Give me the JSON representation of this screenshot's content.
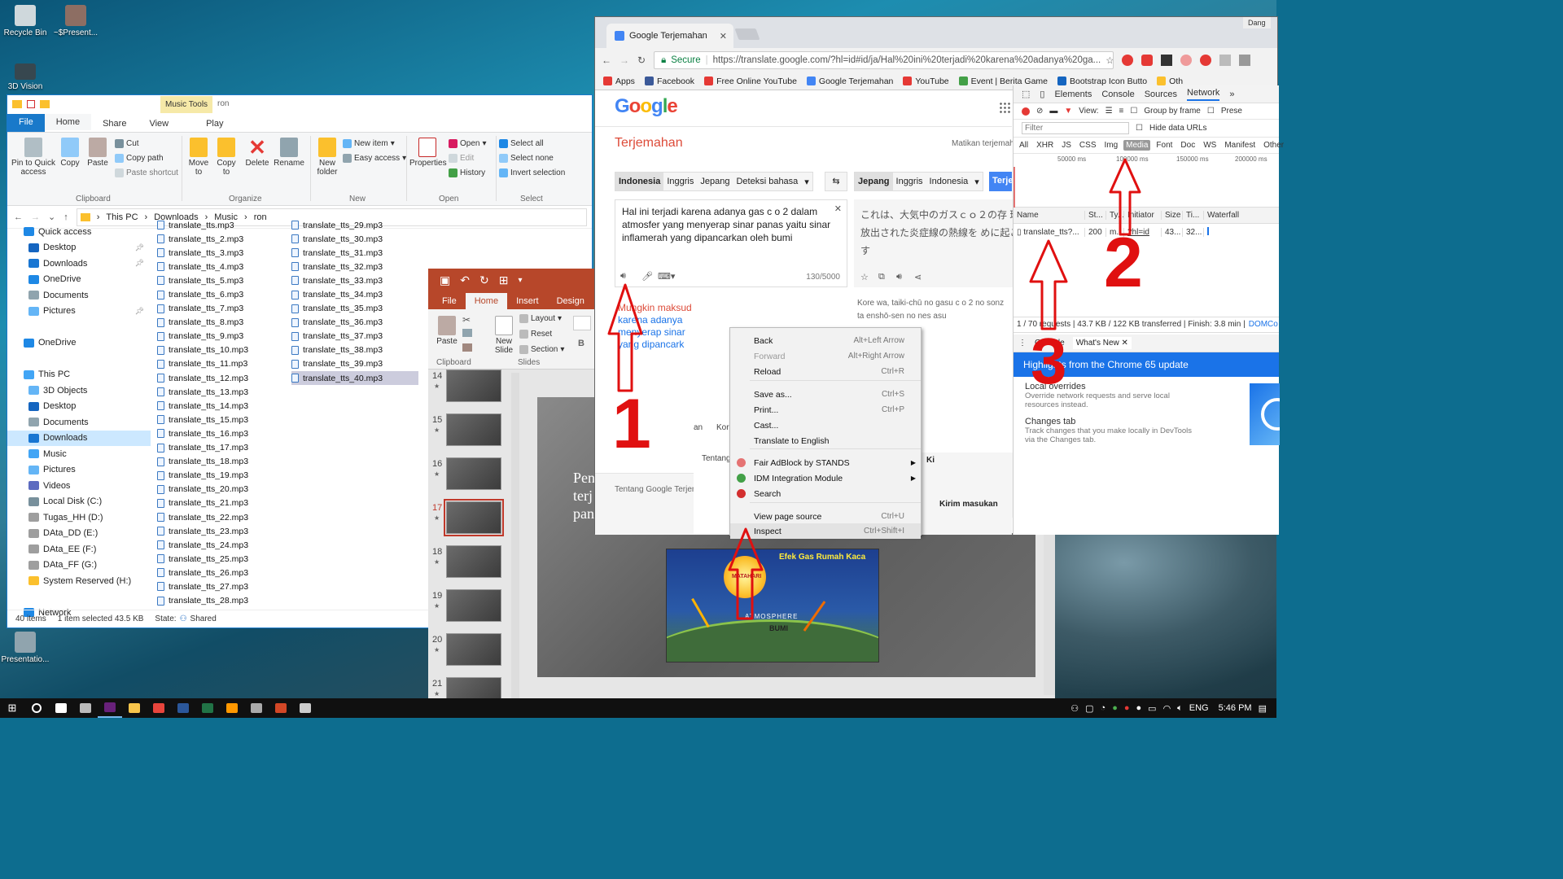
{
  "desktop": {
    "icons": [
      {
        "label": "Recycle Bin",
        "color": "#cfd8dc"
      },
      {
        "label": "~$Present...",
        "color": "#8d6e63"
      },
      {
        "label": "3D Vision",
        "color": "#37474f"
      },
      {
        "label": "Presentatio...",
        "color": "#90a4ae"
      }
    ]
  },
  "explorer": {
    "title": "ron",
    "context_tab": "Music Tools",
    "tabs": [
      "File",
      "Home",
      "Share",
      "View",
      "Play"
    ],
    "ribbon": {
      "clipboard": {
        "pin": "Pin to Quick\naccess",
        "copy": "Copy",
        "paste": "Paste",
        "cut": "Cut",
        "copy_path": "Copy path",
        "paste_shortcut": "Paste shortcut",
        "group": "Clipboard"
      },
      "organize": {
        "move": "Move\nto",
        "copy": "Copy\nto",
        "delete": "Delete",
        "rename": "Rename",
        "group": "Organize"
      },
      "new": {
        "folder": "New\nfolder",
        "new_item": "New item",
        "easy_access": "Easy access",
        "group": "New"
      },
      "open": {
        "properties": "Properties",
        "open": "Open",
        "edit": "Edit",
        "history": "History",
        "group": "Open"
      },
      "select": {
        "all": "Select all",
        "none": "Select none",
        "invert": "Invert selection",
        "group": "Select"
      }
    },
    "path": [
      "This PC",
      "Downloads",
      "Music",
      "ron"
    ],
    "nav": [
      {
        "label": "Quick access",
        "color": "#1e88e5",
        "indent": 0
      },
      {
        "label": "Desktop",
        "color": "#1565c0",
        "indent": 1
      },
      {
        "label": "Downloads",
        "color": "#1976d2",
        "indent": 1
      },
      {
        "label": "OneDrive",
        "color": "#1e88e5",
        "indent": 1
      },
      {
        "label": "Documents",
        "color": "#90a4ae",
        "indent": 1
      },
      {
        "label": "Pictures",
        "color": "#64b5f6",
        "indent": 1
      },
      {
        "label": "",
        "color": "",
        "indent": 0
      },
      {
        "label": "OneDrive",
        "color": "#1e88e5",
        "indent": 0
      },
      {
        "label": "",
        "color": "",
        "indent": 0
      },
      {
        "label": "This PC",
        "color": "#42a5f5",
        "indent": 0
      },
      {
        "label": "3D Objects",
        "color": "#64b5f6",
        "indent": 1
      },
      {
        "label": "Desktop",
        "color": "#1565c0",
        "indent": 1
      },
      {
        "label": "Documents",
        "color": "#90a4ae",
        "indent": 1
      },
      {
        "label": "Downloads",
        "color": "#1976d2",
        "indent": 1
      },
      {
        "label": "Music",
        "color": "#42a5f5",
        "indent": 1
      },
      {
        "label": "Pictures",
        "color": "#64b5f6",
        "indent": 1
      },
      {
        "label": "Videos",
        "color": "#5c6bc0",
        "indent": 1
      },
      {
        "label": "Local Disk (C:)",
        "color": "#78909c",
        "indent": 1
      },
      {
        "label": "Tugas_HH (D:)",
        "color": "#9e9e9e",
        "indent": 1
      },
      {
        "label": "DAta_DD (E:)",
        "color": "#9e9e9e",
        "indent": 1
      },
      {
        "label": "DAta_EE (F:)",
        "color": "#9e9e9e",
        "indent": 1
      },
      {
        "label": "DAta_FF (G:)",
        "color": "#9e9e9e",
        "indent": 1
      },
      {
        "label": "System Reserved (H:)",
        "color": "#fbc02d",
        "indent": 1
      },
      {
        "label": "",
        "color": "",
        "indent": 0
      },
      {
        "label": "Network",
        "color": "#1e88e5",
        "indent": 0
      }
    ],
    "files_col1": [
      "translate_tts.mp3",
      "translate_tts_2.mp3",
      "translate_tts_3.mp3",
      "translate_tts_4.mp3",
      "translate_tts_5.mp3",
      "translate_tts_6.mp3",
      "translate_tts_7.mp3",
      "translate_tts_8.mp3",
      "translate_tts_9.mp3",
      "translate_tts_10.mp3",
      "translate_tts_11.mp3",
      "translate_tts_12.mp3",
      "translate_tts_13.mp3",
      "translate_tts_14.mp3",
      "translate_tts_15.mp3",
      "translate_tts_16.mp3",
      "translate_tts_17.mp3",
      "translate_tts_18.mp3",
      "translate_tts_19.mp3",
      "translate_tts_20.mp3",
      "translate_tts_21.mp3",
      "translate_tts_22.mp3",
      "translate_tts_23.mp3",
      "translate_tts_24.mp3",
      "translate_tts_25.mp3",
      "translate_tts_26.mp3",
      "translate_tts_27.mp3",
      "translate_tts_28.mp3"
    ],
    "files_col2": [
      "translate_tts_29.mp3",
      "translate_tts_30.mp3",
      "translate_tts_31.mp3",
      "translate_tts_32.mp3",
      "translate_tts_33.mp3",
      "translate_tts_34.mp3",
      "translate_tts_35.mp3",
      "translate_tts_36.mp3",
      "translate_tts_37.mp3",
      "translate_tts_38.mp3",
      "translate_tts_39.mp3",
      "translate_tts_40.mp3"
    ],
    "selected_file": "translate_tts_40.mp3",
    "status": {
      "count": "40 items",
      "selected": "1 item selected  43.5 KB",
      "state": "State:",
      "shared": "Shared"
    }
  },
  "ppt": {
    "tabs": [
      "File",
      "Home",
      "Insert",
      "Design"
    ],
    "ribbon": {
      "paste": "Paste",
      "new_slide": "New\nSlide",
      "layout": "Layout",
      "reset": "Reset",
      "section": "Section",
      "clipboard": "Clipboard",
      "slides": "Slides"
    },
    "slide_numbers": [
      "14",
      "15",
      "16",
      "17",
      "18",
      "19",
      "20",
      "21"
    ],
    "active_slide": "17",
    "slide_text": [
      "Pen",
      "terj",
      "pan"
    ],
    "diagram": {
      "title": "Efek Gas Rumah Kaca",
      "sun": "MATAHARI",
      "atmosphere": "ATMOSPHERE",
      "earth": "BUMI"
    }
  },
  "chrome": {
    "tab_title": "Google Terjemahan",
    "url_secure": "Secure",
    "url": "https://translate.google.com/?hl=id#id/ja/Hal%20ini%20terjadi%20karena%20adanya%20ga...",
    "bookmarks": [
      {
        "label": "Apps",
        "color": "#e53935"
      },
      {
        "label": "Facebook",
        "color": "#3b5998"
      },
      {
        "label": "Free Online YouTube",
        "color": "#e53935"
      },
      {
        "label": "Google Terjemahan",
        "color": "#4285f4"
      },
      {
        "label": "YouTube",
        "color": "#e53935"
      },
      {
        "label": "Event | Berita Game",
        "color": "#43a047"
      },
      {
        "label": "Bootstrap Icon Butto",
        "color": "#1565c0"
      },
      {
        "label": "Oth",
        "color": "#fbc02d"
      }
    ],
    "user": "Dang",
    "translate": {
      "heading": "Terjemahan",
      "turn_off": "Matikan terjemah",
      "src_langs": [
        "Indonesia",
        "Inggris",
        "Jepang",
        "Deteksi bahasa"
      ],
      "tgt_langs": [
        "Jepang",
        "Inggris",
        "Indonesia"
      ],
      "translate_btn": "Terje",
      "source_text": "Hal ini terjadi karena adanya gas c o 2 dalam atmosfer yang menyerap sinar panas yaitu sinar inflamerah yang dipancarkan oleh bumi",
      "char_count": "130/5000",
      "result_text": "これは、大気中のガスｃｏ２の存 球から放出された炎症線の熱線を めに起こります",
      "romaji": "Kore wa, taiki-chū no gasu c o 2 no sonz ta enshō-sen no nes asu",
      "suggest_prefix": "Mungkin maksud",
      "suggest_lines": [
        "karena adanya",
        "menyerap sinar",
        "yang dipancark"
      ],
      "footer_about": "Tentang Google Terjem",
      "footer_send": "Kirim masukan",
      "footer_frag1": "Tentang",
      "footer_frag2": "an",
      "footer_frag3": "Kor",
      "footer_frag4": "Ki"
    },
    "devtools": {
      "tabs": [
        "Elements",
        "Console",
        "Sources",
        "Network"
      ],
      "view": "View:",
      "group_by_frame": "Group by frame",
      "preserve": "Prese",
      "filter_placeholder": "Filter",
      "hide_data_urls": "Hide data URLs",
      "filters": [
        "All",
        "XHR",
        "JS",
        "CSS",
        "Img",
        "Media",
        "Font",
        "Doc",
        "WS",
        "Manifest",
        "Other"
      ],
      "active_filter": "Media",
      "timeline": [
        "50000 ms",
        "100000 ms",
        "150000 ms",
        "200000 ms"
      ],
      "columns": [
        "Name",
        "St...",
        "Ty...",
        "Initiator",
        "Size",
        "Ti...",
        "Waterfall"
      ],
      "row": [
        "translate_tts?...",
        "200",
        "m...",
        "?hl=id",
        "43...",
        "32..."
      ],
      "summary": "1 / 70 requests  |  43.7 KB / 122 KB transferred  |  Finish: 3.8 min  |",
      "dom_link": "DOMCo",
      "drawer_tabs": [
        "Console",
        "What's New"
      ],
      "highlights": "Highlights from the Chrome 65 update",
      "news": [
        {
          "title": "Local overrides",
          "body": "Override network requests and serve local resources instead."
        },
        {
          "title": "Changes tab",
          "body": "Track changes that you make locally in DevTools via the Changes tab."
        }
      ]
    }
  },
  "context_menu": [
    {
      "label": "Back",
      "shortcut": "Alt+Left Arrow",
      "disabled": false,
      "icon": ""
    },
    {
      "label": "Forward",
      "shortcut": "Alt+Right Arrow",
      "disabled": true,
      "icon": ""
    },
    {
      "label": "Reload",
      "shortcut": "Ctrl+R",
      "disabled": false,
      "icon": ""
    },
    {
      "label": "Save as...",
      "shortcut": "Ctrl+S",
      "disabled": false,
      "icon": ""
    },
    {
      "label": "Print...",
      "shortcut": "Ctrl+P",
      "disabled": false,
      "icon": ""
    },
    {
      "label": "Cast...",
      "shortcut": "",
      "disabled": false,
      "icon": ""
    },
    {
      "label": "Translate to English",
      "shortcut": "",
      "disabled": false,
      "icon": ""
    },
    {
      "label": "Fair AdBlock by STANDS",
      "shortcut": "",
      "disabled": false,
      "icon": "#e57373"
    },
    {
      "label": "IDM Integration Module",
      "shortcut": "",
      "disabled": false,
      "icon": "#43a047"
    },
    {
      "label": "Search",
      "shortcut": "",
      "disabled": false,
      "icon": "#d32f2f"
    },
    {
      "label": "View page source",
      "shortcut": "Ctrl+U",
      "disabled": false,
      "icon": ""
    },
    {
      "label": "Inspect",
      "shortcut": "Ctrl+Shift+I",
      "disabled": false,
      "icon": ""
    }
  ],
  "annotations": {
    "n1": "1",
    "n2": "2",
    "n3": "3",
    "color": "#e01010"
  },
  "taskbar": {
    "apps": [
      "#ffffff",
      "#bbbbbb",
      "#68217a",
      "#f8c54b",
      "#e8453c",
      "#2b579a",
      "#217346",
      "#ff9800",
      "#aaaaaa",
      "#d24726",
      "#cccccc"
    ],
    "lang": "ENG",
    "time": "5:46 PM"
  }
}
